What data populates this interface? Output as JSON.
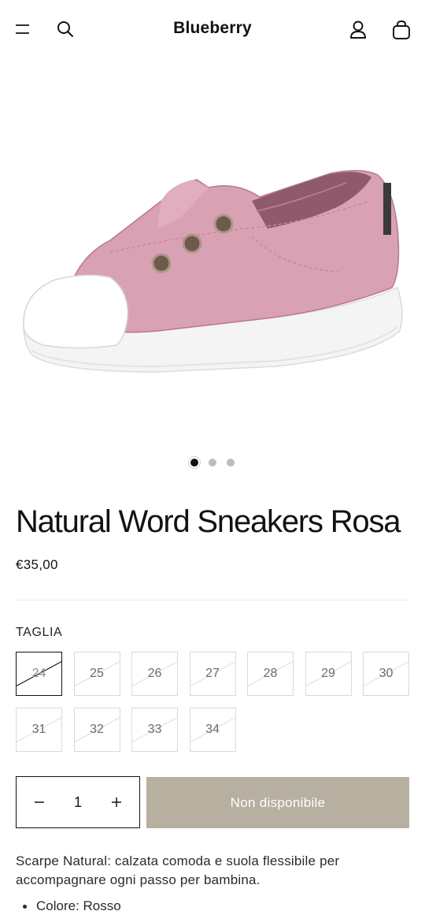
{
  "header": {
    "brand": "Blueberry",
    "icons": [
      "menu-icon",
      "search-icon",
      "account-icon",
      "cart-icon"
    ]
  },
  "gallery": {
    "image": "pink-canvas-slip-on-sneaker",
    "dots_total": 3,
    "dots_active": 1
  },
  "product": {
    "title": "Natural Word Sneakers Rosa",
    "price": "€35,00",
    "size_label": "TAGLIA",
    "sizes": [
      {
        "label": "24",
        "available": false,
        "selected": true
      },
      {
        "label": "25",
        "available": false,
        "selected": false
      },
      {
        "label": "26",
        "available": false,
        "selected": false
      },
      {
        "label": "27",
        "available": false,
        "selected": false
      },
      {
        "label": "28",
        "available": false,
        "selected": false
      },
      {
        "label": "29",
        "available": false,
        "selected": false
      },
      {
        "label": "30",
        "available": false,
        "selected": false
      },
      {
        "label": "31",
        "available": false,
        "selected": false
      },
      {
        "label": "32",
        "available": false,
        "selected": false
      },
      {
        "label": "33",
        "available": false,
        "selected": false
      },
      {
        "label": "34",
        "available": false,
        "selected": false
      }
    ],
    "quantity": "1",
    "add_button_label": "Non disponibile",
    "description": "Scarpe Natural: calzata comoda e suola flessibile per accompagnare ogni passo per bambina.",
    "bullets": [
      "Colore: Rosso"
    ]
  },
  "colors": {
    "button_disabled": "#b7afa0",
    "text": "#121212",
    "shoe_pink": "#d8a0b2"
  }
}
